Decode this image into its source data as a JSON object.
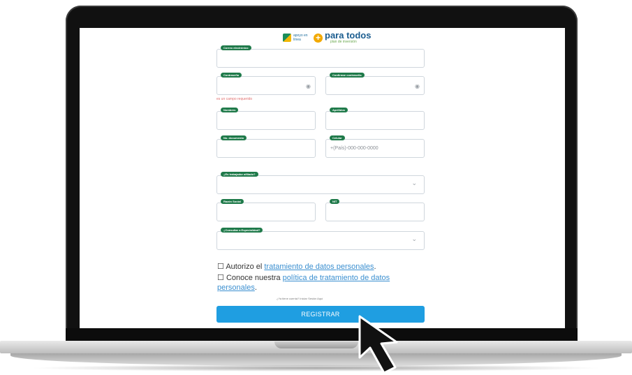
{
  "logo": {
    "small_text": "apoyo en línea",
    "plus": "+",
    "main": "para todos",
    "sub": "plan de inversión"
  },
  "form": {
    "email": {
      "label": "Correo electrónico"
    },
    "password": {
      "label": "Contraseña"
    },
    "confirm_password": {
      "label": "Confirmar contraseña"
    },
    "password_error": "es un campo requerido",
    "first_name": {
      "label": "Nombres"
    },
    "last_name": {
      "label": "Apellidos"
    },
    "birthdate": {
      "label": "No. documento"
    },
    "phone": {
      "label": "Celular",
      "placeholder": "+(País)-000-000-0000"
    },
    "company_question": {
      "label": "¿Es trabajador afiliado?"
    },
    "company_name": {
      "label": "Razón Social"
    },
    "nit": {
      "label": "NIT"
    },
    "specialty": {
      "label": "¿Consultar a Especialidad?"
    }
  },
  "consent": {
    "checkbox1_prefix": "Autorizo el",
    "checkbox1_link": "tratamiento de datos personales",
    "checkbox1_suffix": ".",
    "checkbox2_prefix": "Conoce nuestra",
    "checkbox2_link": "política de tratamiento de datos personales",
    "checkbox2_suffix": "."
  },
  "login_prompt": "¿Ya tiene cuenta? Iniciar Sesión Aquí",
  "submit_label": "REGISTRAR",
  "colors": {
    "accent": "#1f9ee1",
    "tag": "#1f7a4a",
    "link": "#3b8fd0"
  }
}
